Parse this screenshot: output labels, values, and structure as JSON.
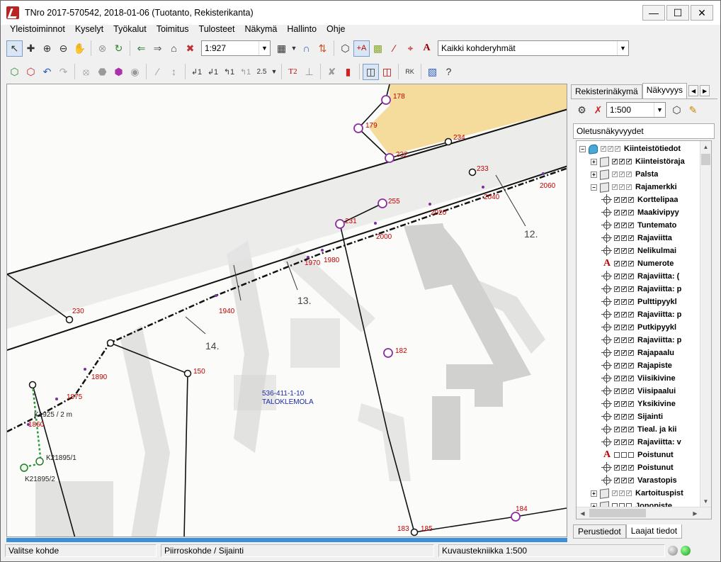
{
  "window": {
    "title": "TNro 2017-570542, 2018-01-06 (Tuotanto, Rekisterikanta)"
  },
  "menu": [
    "Yleistoiminnot",
    "Kyselyt",
    "Työkalut",
    "Toimitus",
    "Tulosteet",
    "Näkymä",
    "Hallinto",
    "Ohje"
  ],
  "toolbar": {
    "scale": "1:927",
    "group": "Kaikki kohderyhmät"
  },
  "map": {
    "numbers": [
      "178",
      "179",
      "234",
      "232",
      "233",
      "2060",
      "2040",
      "12.",
      "255",
      "2020",
      "231",
      "2000",
      "1980",
      "1970",
      "13.",
      "230",
      "1940",
      "14.",
      "182",
      "1890",
      "150",
      "1875",
      "1860",
      "183",
      "185",
      "184"
    ],
    "parcel": {
      "id": "536-411-1-10",
      "name": "TALOKLEMOLA"
    },
    "measure": "K1925 / 2 m",
    "points": [
      "K21895/1",
      "K21895/2"
    ]
  },
  "panel": {
    "tabs": [
      "Rekisterinäkymä",
      "Näkyvyys"
    ],
    "scale": "1:500",
    "profile": "Oletusnäkyvyydet",
    "tree": [
      {
        "label": "Kiinteistötiedot",
        "level": 0,
        "toggle": "−",
        "icon": "db",
        "checks": "gray"
      },
      {
        "label": "Kiinteistöraja",
        "level": 1,
        "toggle": "+",
        "icon": "cube",
        "checks": "on"
      },
      {
        "label": "Palsta",
        "level": 1,
        "toggle": "+",
        "icon": "cube",
        "checks": "gray"
      },
      {
        "label": "Rajamerkki",
        "level": 1,
        "toggle": "−",
        "icon": "cube",
        "checks": "gray"
      },
      {
        "label": "Korttelipaa",
        "level": 2,
        "icon": "target",
        "checks": "on"
      },
      {
        "label": "Maakivipyy",
        "level": 2,
        "icon": "target",
        "checks": "on"
      },
      {
        "label": "Tuntemato",
        "level": 2,
        "icon": "target",
        "checks": "on"
      },
      {
        "label": "Rajaviitta",
        "level": 2,
        "icon": "target",
        "checks": "on"
      },
      {
        "label": "Nelikulmai",
        "level": 2,
        "icon": "target",
        "checks": "on"
      },
      {
        "label": "Numerote",
        "level": 2,
        "icon": "letter",
        "checks": "on"
      },
      {
        "label": "Rajaviitta: (",
        "level": 2,
        "icon": "target",
        "checks": "on"
      },
      {
        "label": "Rajaviitta: p",
        "level": 2,
        "icon": "target",
        "checks": "on"
      },
      {
        "label": "Pulttipyykl",
        "level": 2,
        "icon": "target",
        "checks": "on"
      },
      {
        "label": "Rajaviitta: p",
        "level": 2,
        "icon": "target",
        "checks": "on"
      },
      {
        "label": "Putkipyykl",
        "level": 2,
        "icon": "target",
        "checks": "on"
      },
      {
        "label": "Rajaviitta: p",
        "level": 2,
        "icon": "target",
        "checks": "on"
      },
      {
        "label": "Rajapaalu",
        "level": 2,
        "icon": "target",
        "checks": "on"
      },
      {
        "label": "Rajapiste",
        "level": 2,
        "icon": "target",
        "checks": "on"
      },
      {
        "label": "Viisikivine",
        "level": 2,
        "icon": "target",
        "checks": "on"
      },
      {
        "label": "Viisipaalui",
        "level": 2,
        "icon": "target",
        "checks": "on"
      },
      {
        "label": "Yksikivine",
        "level": 2,
        "icon": "target",
        "checks": "on"
      },
      {
        "label": "Sijainti",
        "level": 2,
        "icon": "target",
        "checks": "on"
      },
      {
        "label": "Tieal. ja kii",
        "level": 2,
        "icon": "target",
        "checks": "on"
      },
      {
        "label": "Rajaviitta: v",
        "level": 2,
        "icon": "target",
        "checks": "on"
      },
      {
        "label": "Poistunut",
        "level": 2,
        "icon": "letter",
        "checks": "off"
      },
      {
        "label": "Poistunut",
        "level": 2,
        "icon": "target",
        "checks": "on"
      },
      {
        "label": "Varastopis",
        "level": 2,
        "icon": "target",
        "checks": "on"
      },
      {
        "label": "Kartoituspist",
        "level": 1,
        "toggle": "+",
        "icon": "cube",
        "checks": "gray"
      },
      {
        "label": "Jonopiste",
        "level": 1,
        "toggle": "+",
        "icon": "cube",
        "checks": "off"
      }
    ],
    "bottom_tabs": [
      "Perustiedot",
      "Laajat tiedot"
    ]
  },
  "status": {
    "left": "Valitse kohde",
    "mid": "Piirroskohde / Sijainti",
    "right": "Kuvaustekniikka 1:500"
  }
}
